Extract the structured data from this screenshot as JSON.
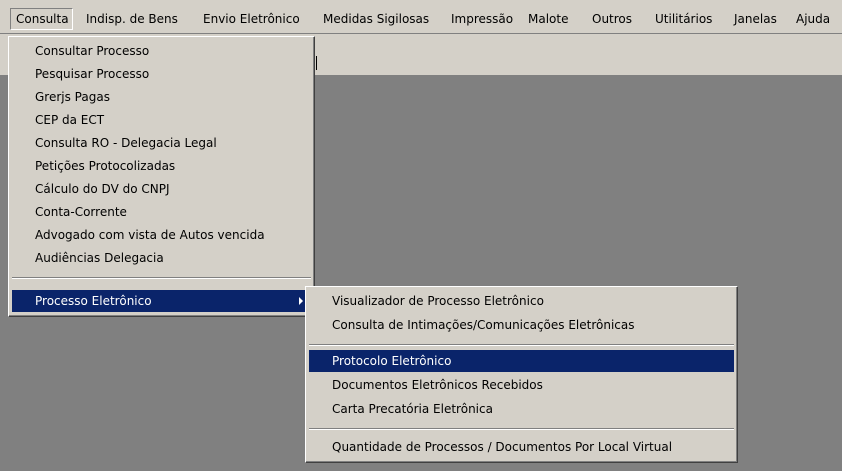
{
  "menubar": {
    "items": [
      {
        "label": "Consulta"
      },
      {
        "label": "Indisp. de Bens"
      },
      {
        "label": "Envio Eletrônico"
      },
      {
        "label": "Medidas Sigilosas"
      },
      {
        "label": "Impressão"
      },
      {
        "label": "Malote"
      },
      {
        "label": "Outros"
      },
      {
        "label": "Utilitários"
      },
      {
        "label": "Janelas"
      },
      {
        "label": "Ajuda"
      }
    ]
  },
  "consulta_menu": {
    "items": [
      {
        "label": "Consultar Processo"
      },
      {
        "label": "Pesquisar Processo"
      },
      {
        "label": "Grerjs Pagas"
      },
      {
        "label": "CEP da ECT"
      },
      {
        "label": "Consulta RO - Delegacia Legal"
      },
      {
        "label": "Petições Protocolizadas"
      },
      {
        "label": "Cálculo do DV do CNPJ"
      },
      {
        "label": "Conta-Corrente"
      },
      {
        "label": "Advogado com vista de Autos vencida"
      },
      {
        "label": "Audiências Delegacia"
      },
      {
        "label": "Processo Eletrônico"
      }
    ]
  },
  "processo_eletronico_menu": {
    "items": [
      {
        "label": "Visualizador de Processo Eletrônico"
      },
      {
        "label": "Consulta de Intimações/Comunicações Eletrônicas"
      },
      {
        "label": "Protocolo Eletrônico"
      },
      {
        "label": "Documentos Eletrônicos Recebidos"
      },
      {
        "label": "Carta Precatória Eletrônica"
      },
      {
        "label": "Quantidade de Processos / Documentos Por Local Virtual"
      }
    ]
  },
  "colors": {
    "face": "#d4d0c8",
    "workspace": "#808080",
    "highlight": "#0a246a",
    "highlight_text": "#ffffff"
  }
}
